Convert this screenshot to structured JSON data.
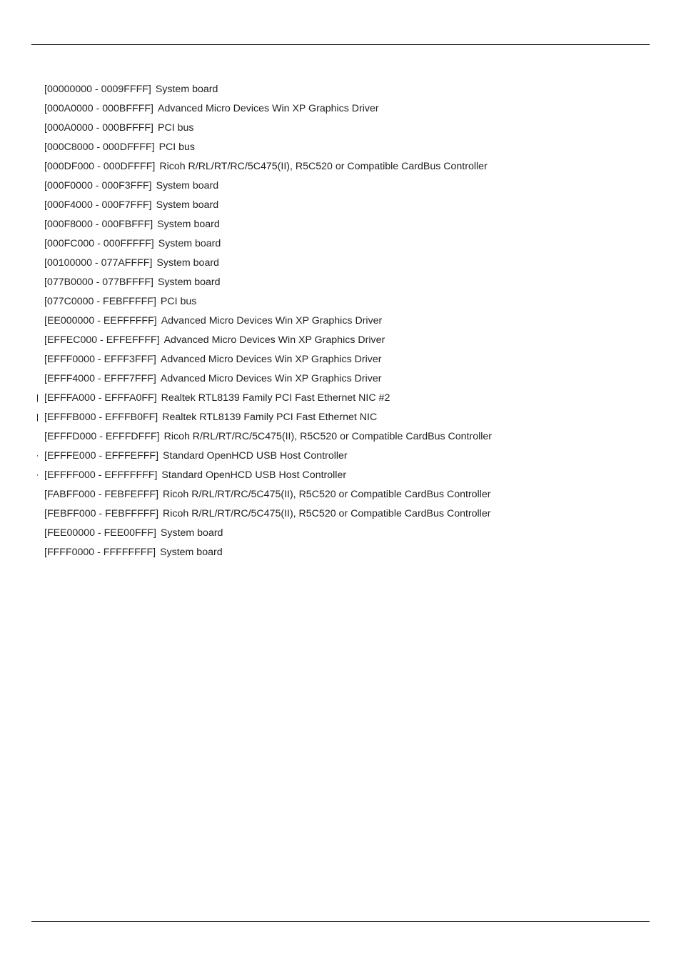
{
  "memory_resources": [
    {
      "marker": "",
      "range": "[00000000 - 0009FFFF]",
      "device": "System board"
    },
    {
      "marker": "",
      "range": "[000A0000 - 000BFFFF]",
      "device": "Advanced Micro Devices Win XP Graphics Driver"
    },
    {
      "marker": "",
      "range": "[000A0000 - 000BFFFF]",
      "device": "PCI bus"
    },
    {
      "marker": "",
      "range": "[000C8000 - 000DFFFF]",
      "device": "PCI bus"
    },
    {
      "marker": "",
      "range": "[000DF000 - 000DFFFF]",
      "device": "Ricoh R/RL/RT/RC/5C475(II), R5C520 or Compatible CardBus Controller"
    },
    {
      "marker": "",
      "range": "[000F0000 - 000F3FFF]",
      "device": "System board"
    },
    {
      "marker": "",
      "range": "[000F4000 - 000F7FFF]",
      "device": "System board"
    },
    {
      "marker": "",
      "range": "[000F8000 - 000FBFFF]",
      "device": "System board"
    },
    {
      "marker": "",
      "range": "[000FC000 - 000FFFFF]",
      "device": "System board"
    },
    {
      "marker": "",
      "range": "[00100000 - 077AFFFF]",
      "device": "System board"
    },
    {
      "marker": "",
      "range": "[077B0000 - 077BFFFF]",
      "device": "System board"
    },
    {
      "marker": "",
      "range": "[077C0000 - FEBFFFFF]",
      "device": "PCI bus"
    },
    {
      "marker": "",
      "range": "[EE000000 - EEFFFFFF]",
      "device": "Advanced Micro Devices Win XP Graphics Driver"
    },
    {
      "marker": "",
      "range": "[EFFEC000 - EFFEFFFF]",
      "device": "Advanced Micro Devices Win XP Graphics Driver"
    },
    {
      "marker": "",
      "range": "[EFFF0000 - EFFF3FFF]",
      "device": "Advanced Micro Devices Win XP Graphics Driver"
    },
    {
      "marker": "",
      "range": "[EFFF4000 - EFFF7FFF]",
      "device": "Advanced Micro Devices Win XP Graphics Driver"
    },
    {
      "marker": "|",
      "range": "[EFFFA000 - EFFFA0FF]",
      "device": "Realtek RTL8139 Family PCI Fast Ethernet NIC #2"
    },
    {
      "marker": "|",
      "range": "[EFFFB000 - EFFFB0FF]",
      "device": "Realtek RTL8139 Family PCI Fast Ethernet NIC"
    },
    {
      "marker": "",
      "range": "[EFFFD000 - EFFFDFFF]",
      "device": "Ricoh R/RL/RT/RC/5C475(II), R5C520 or Compatible CardBus Controller"
    },
    {
      "marker": "·",
      "range": "[EFFFE000 - EFFFEFFF]",
      "device": "Standard OpenHCD USB Host Controller"
    },
    {
      "marker": "·",
      "range": "[EFFFF000 - EFFFFFFF]",
      "device": "Standard OpenHCD USB Host Controller"
    },
    {
      "marker": "",
      "range": "[FABFF000 - FEBFEFFF]",
      "device": "Ricoh R/RL/RT/RC/5C475(II), R5C520 or Compatible CardBus Controller"
    },
    {
      "marker": "",
      "range": "[FEBFF000 - FEBFFFFF]",
      "device": "Ricoh R/RL/RT/RC/5C475(II), R5C520 or Compatible CardBus Controller"
    },
    {
      "marker": "",
      "range": "[FEE00000 - FEE00FFF]",
      "device": "System board"
    },
    {
      "marker": "",
      "range": "[FFFF0000 - FFFFFFFF]",
      "device": "System board"
    }
  ]
}
